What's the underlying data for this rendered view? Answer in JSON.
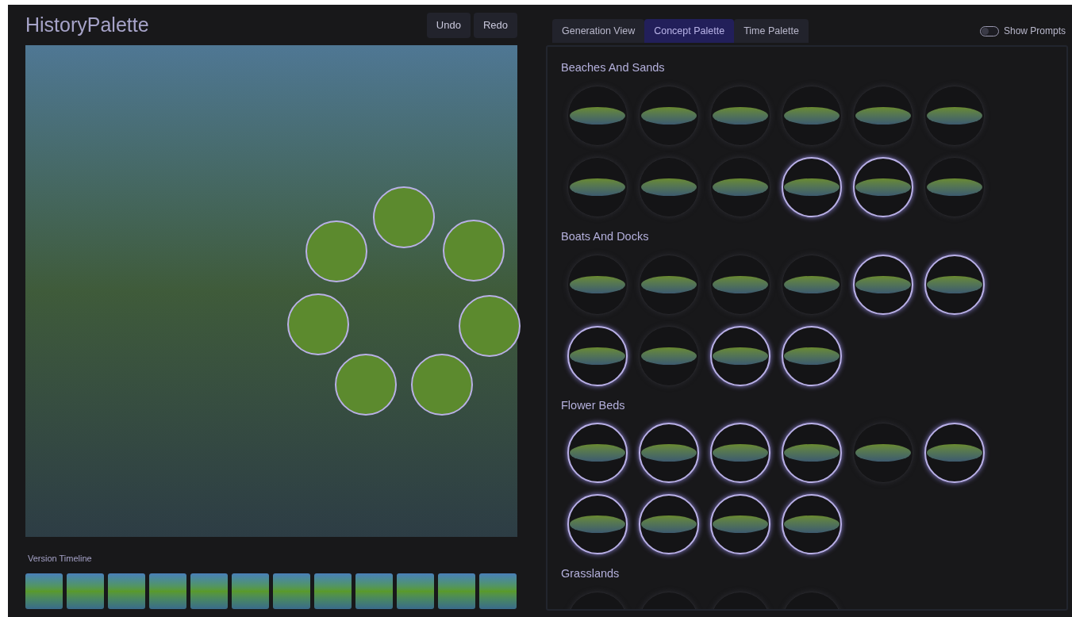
{
  "app": {
    "title": "HistoryPalette"
  },
  "history_buttons": [
    "Undo",
    "Redo"
  ],
  "tabs": [
    {
      "label": "Generation View",
      "selected": false
    },
    {
      "label": "Concept Palette",
      "selected": true
    },
    {
      "label": "Time Palette",
      "selected": false
    }
  ],
  "show_prompts": {
    "label": "Show Prompts",
    "on": false
  },
  "timeline": {
    "label": "Version Timeline"
  },
  "categories": [
    {
      "title": "Beaches And Sands",
      "concepts": [
        {
          "selected": false
        },
        {
          "selected": false
        },
        {
          "selected": false
        },
        {
          "selected": false
        },
        {
          "selected": false
        },
        {
          "selected": false
        },
        {
          "selected": false
        },
        {
          "selected": false
        },
        {
          "selected": false
        },
        {
          "selected": true
        },
        {
          "selected": true
        },
        {
          "selected": false
        }
      ]
    },
    {
      "title": "Boats And Docks",
      "concepts": [
        {
          "selected": false
        },
        {
          "selected": false
        },
        {
          "selected": false
        },
        {
          "selected": false
        },
        {
          "selected": true
        },
        {
          "selected": true
        },
        {
          "selected": true
        },
        {
          "selected": false
        },
        {
          "selected": true
        },
        {
          "selected": true
        }
      ]
    },
    {
      "title": "Flower Beds",
      "concepts": [
        {
          "selected": true
        },
        {
          "selected": true
        },
        {
          "selected": true
        },
        {
          "selected": true
        },
        {
          "selected": false
        },
        {
          "selected": true
        },
        {
          "selected": true
        },
        {
          "selected": true
        },
        {
          "selected": true
        },
        {
          "selected": true
        }
      ]
    },
    {
      "title": "Grasslands",
      "concepts": [
        {
          "selected": false
        },
        {
          "selected": false
        },
        {
          "selected": false
        },
        {
          "selected": false
        }
      ]
    }
  ]
}
